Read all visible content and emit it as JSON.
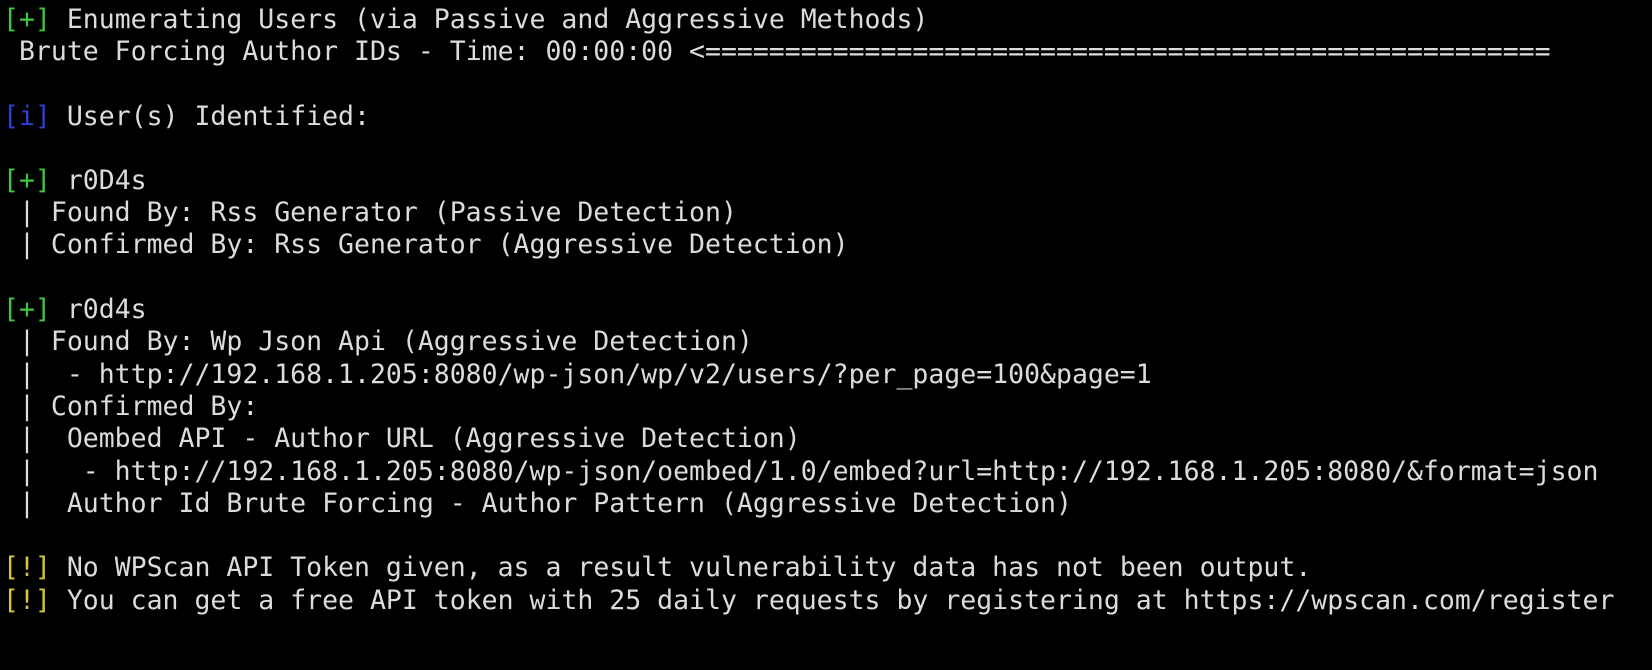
{
  "terminal": {
    "colors": {
      "background": "#000000",
      "text": "#dcdcdc",
      "plus_tag": "#3fc63f",
      "info_tag": "#2f3fd8",
      "warn_tag": "#d6c53a"
    },
    "lines": [
      {
        "tag": "[+]",
        "text": " Enumerating Users (via Passive and Aggressive Methods)"
      },
      {
        "tag": "",
        "text": " Brute Forcing Author IDs - Time: 00:00:00 <====================================================="
      },
      {
        "tag": "[i]",
        "text": " User(s) Identified:"
      },
      {
        "tag": "[+]",
        "text": " r0D4s"
      },
      {
        "tag": "",
        "text": " | Found By: Rss Generator (Passive Detection)"
      },
      {
        "tag": "",
        "text": " | Confirmed By: Rss Generator (Aggressive Detection)"
      },
      {
        "tag": "[+]",
        "text": " r0d4s"
      },
      {
        "tag": "",
        "text": " | Found By: Wp Json Api (Aggressive Detection)"
      },
      {
        "tag": "",
        "text": " |  - http://192.168.1.205:8080/wp-json/wp/v2/users/?per_page=100&page=1"
      },
      {
        "tag": "",
        "text": " | Confirmed By:"
      },
      {
        "tag": "",
        "text": " |  Oembed API - Author URL (Aggressive Detection)"
      },
      {
        "tag": "",
        "text": " |   - http://192.168.1.205:8080/wp-json/oembed/1.0/embed?url=http://192.168.1.205:8080/&format=json"
      },
      {
        "tag": "",
        "text": " |  Author Id Brute Forcing - Author Pattern (Aggressive Detection)"
      },
      {
        "tag": "[!]",
        "text": " No WPScan API Token given, as a result vulnerability data has not been output."
      },
      {
        "tag": "[!]",
        "text": " You can get a free API token with 25 daily requests by registering at https://wpscan.com/register"
      }
    ]
  }
}
